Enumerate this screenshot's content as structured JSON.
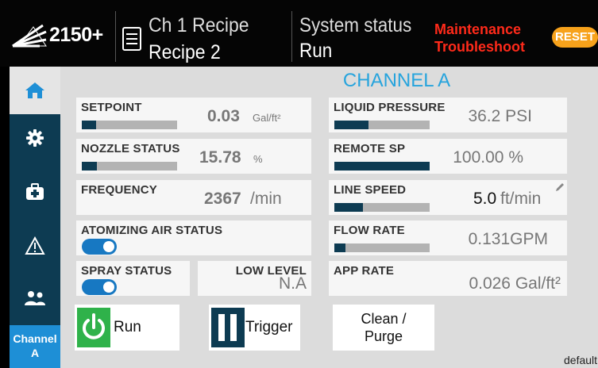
{
  "header": {
    "model": "2150+",
    "channel_recipe_label": "Ch 1 Recipe",
    "recipe_name": "Recipe 2",
    "system_status_label": "System status",
    "system_status_value": "Run",
    "maintenance_line1": "Maintenance",
    "maintenance_line2": "Troubleshoot",
    "reset_label": "RESET"
  },
  "sidebar": {
    "items": [
      {
        "icon": "home-icon"
      },
      {
        "icon": "gear-icon"
      },
      {
        "icon": "toolbox-icon"
      },
      {
        "icon": "warning-icon"
      },
      {
        "icon": "users-icon"
      }
    ],
    "channel_line1": "Channel",
    "channel_line2": "A"
  },
  "main": {
    "channel_title": "CHANNEL A",
    "setpoint": {
      "label": "SETPOINT",
      "value": "0.03",
      "unit": "Gal/ft²",
      "level": 0.15
    },
    "nozzle_status": {
      "label": "NOZZLE STATUS",
      "value": "15.78",
      "unit": "%",
      "level": 0.16
    },
    "frequency": {
      "label": "FREQUENCY",
      "value": "2367",
      "unit": "/min"
    },
    "atomizing_air": {
      "label": "ATOMIZING AIR STATUS",
      "on": true
    },
    "spray_status": {
      "label": "SPRAY STATUS",
      "on": true
    },
    "low_level": {
      "label": "LOW LEVEL",
      "value": "N.A"
    },
    "liquid_pressure": {
      "label": "LIQUID PRESSURE",
      "value": "36.2 PSI",
      "level": 0.36
    },
    "remote_sp": {
      "label": "REMOTE SP",
      "value": "100.00 %",
      "level": 1.0
    },
    "line_speed": {
      "label": "LINE SPEED",
      "value": "5.0",
      "unit": "ft/min",
      "level": 0.3
    },
    "flow_rate": {
      "label": "FLOW RATE",
      "value": "0.131GPM",
      "level": 0.12
    },
    "app_rate": {
      "label": "APP RATE",
      "value": "0.026 Gal/ft²"
    },
    "run_label": "Run",
    "trigger_label": "Trigger",
    "clean_line1": "Clean /",
    "clean_line2": "Purge",
    "default_label": "default"
  },
  "colors": {
    "accent": "#27a4dd",
    "navy": "#0d3b52",
    "alert": "#ff2a1a",
    "reset": "#f7a21b",
    "run_green": "#2fb24a",
    "toggle_blue": "#1778c2"
  }
}
